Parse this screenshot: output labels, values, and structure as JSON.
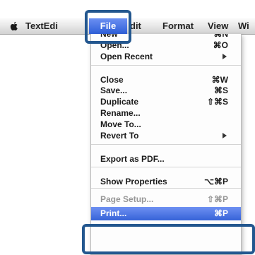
{
  "menubar": {
    "app_name": "TextEdi",
    "menus": [
      "File",
      "dit",
      "Format",
      "View",
      "Wi"
    ],
    "active_menu": "File"
  },
  "file_menu": {
    "groups": [
      [
        {
          "label": "New",
          "shortcut": "⌘N"
        },
        {
          "label": "Open...",
          "shortcut": "⌘O"
        },
        {
          "label": "Open Recent",
          "submenu": true
        }
      ],
      [
        {
          "label": "Close",
          "shortcut": "⌘W"
        },
        {
          "label": "Save...",
          "shortcut": "⌘S"
        },
        {
          "label": "Duplicate",
          "shortcut": "⇧⌘S"
        },
        {
          "label": "Rename..."
        },
        {
          "label": "Move To..."
        },
        {
          "label": "Revert To",
          "submenu": true
        }
      ],
      [
        {
          "label": "Export as PDF..."
        }
      ],
      [
        {
          "label": "Show Properties",
          "shortcut": "⌥⌘P"
        }
      ],
      [
        {
          "label": "Page Setup...",
          "shortcut": "⇧⌘P"
        },
        {
          "label": "Print...",
          "shortcut": "⌘P",
          "selected": true
        }
      ]
    ]
  },
  "colors": {
    "selection": "#3563d8",
    "highlight_outline": "#23578f"
  }
}
